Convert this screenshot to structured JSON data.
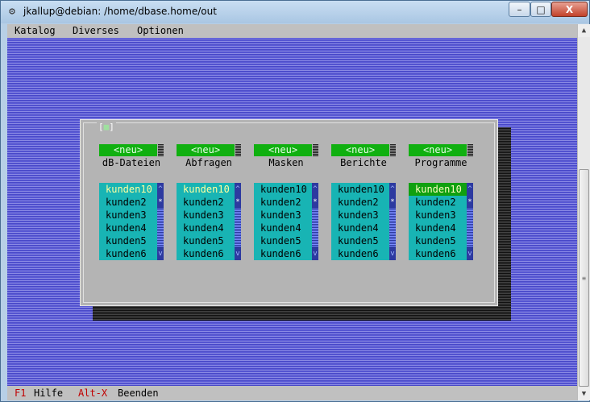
{
  "window": {
    "title": "jkallup@debian: /home/dbase.home/out",
    "minimize_glyph": "–",
    "maximize_glyph": "□",
    "close_glyph": "X"
  },
  "menu": {
    "items": [
      "Katalog",
      "Diverses",
      "Optionen"
    ]
  },
  "status": {
    "f1_key": "F1",
    "f1_label": "Hilfe",
    "altx_key": "Alt-X",
    "altx_label": "Beenden"
  },
  "dialog": {
    "corner_left": "[",
    "corner_mark": "■",
    "corner_right": "]",
    "columns": [
      {
        "button": "<neu>",
        "label": "dB-Dateien",
        "items": [
          "kunden10",
          "kunden2",
          "kunden3",
          "kunden4",
          "kunden5",
          "kunden6"
        ],
        "current_index": 0,
        "selected_index": -1
      },
      {
        "button": "<neu>",
        "label": "Abfragen",
        "items": [
          "kunden10",
          "kunden2",
          "kunden3",
          "kunden4",
          "kunden5",
          "kunden6"
        ],
        "current_index": 0,
        "selected_index": -1
      },
      {
        "button": "<neu>",
        "label": "Masken",
        "items": [
          "kunden10",
          "kunden2",
          "kunden3",
          "kunden4",
          "kunden5",
          "kunden6"
        ],
        "current_index": -1,
        "selected_index": -1
      },
      {
        "button": "<neu>",
        "label": "Berichte",
        "items": [
          "kunden10",
          "kunden2",
          "kunden3",
          "kunden4",
          "kunden5",
          "kunden6"
        ],
        "current_index": -1,
        "selected_index": -1
      },
      {
        "button": "<neu>",
        "label": "Programme",
        "items": [
          "kunden10",
          "kunden2",
          "kunden3",
          "kunden4",
          "kunden5",
          "kunden6"
        ],
        "current_index": -1,
        "selected_index": 0
      }
    ],
    "list_scroll": {
      "up_glyph": "^",
      "thumb_glyph": "*",
      "down_glyph": "v"
    }
  },
  "scrollbar": {
    "up_glyph": "▲",
    "down_glyph": "▼",
    "grip_glyph": "≡"
  },
  "colors": {
    "terminal_bg": "#6a6ad0",
    "menu_bg": "#c0c0c0",
    "hotkey": "#c00000",
    "button_green": "#10b010",
    "list_cyan": "#18b4b4",
    "selected_green": "#10a010"
  }
}
